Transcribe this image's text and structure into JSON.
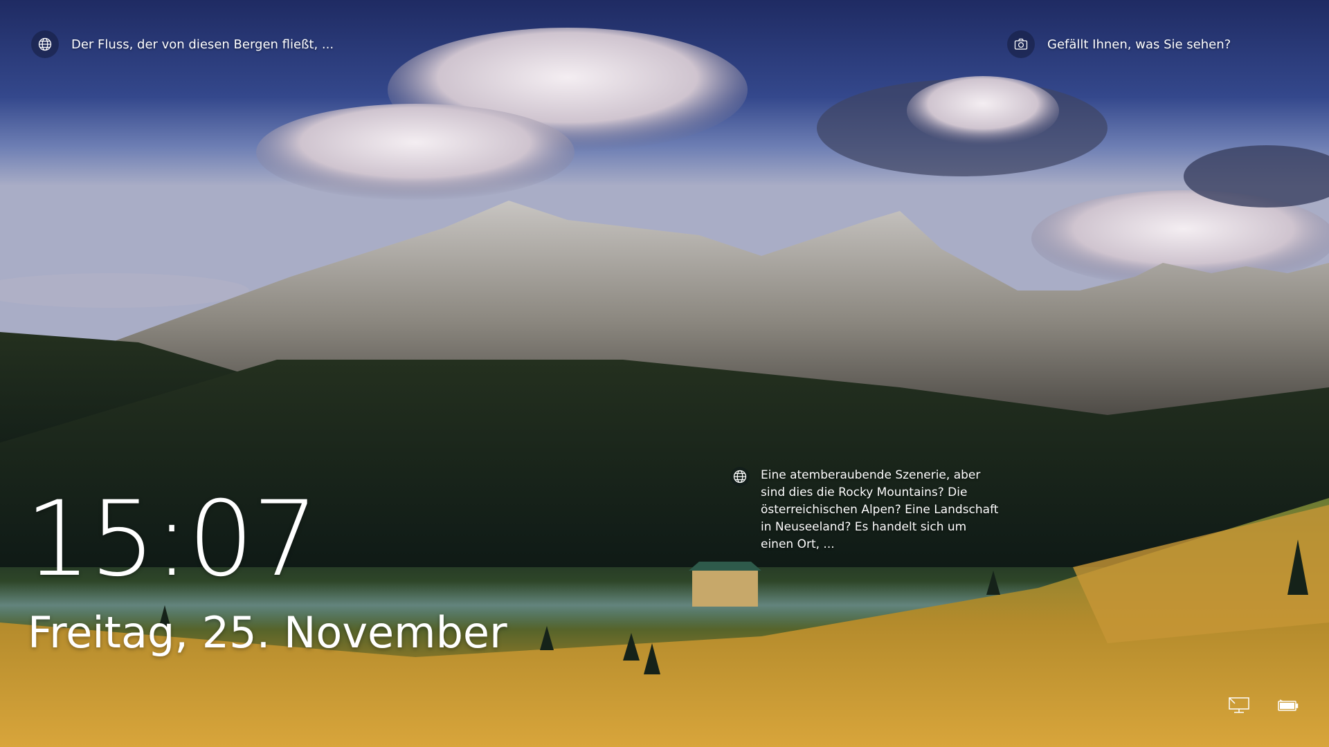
{
  "lockscreen": {
    "image_caption": "Der Fluss, der von diesen Bergen fließt, ...",
    "like_prompt": "Gefällt Ihnen, was Sie sehen?",
    "hotspot_text": "Eine atemberaubende Szenerie, aber sind dies die Rocky Mountains? Die österreichischen Alpen? Eine Landschaft in Neuseeland? Es handelt sich um einen Ort, ...",
    "time": "15:07",
    "date": "Freitag, 25. November"
  },
  "icons": {
    "caption": "globe-icon",
    "like": "camera-icon",
    "hotspot": "globe-icon",
    "network": "network-icon",
    "battery": "battery-icon"
  },
  "colors": {
    "sky_top": "#23306a",
    "forest": "#1b2a23",
    "meadow": "#c99a35",
    "text": "#ffffff"
  }
}
